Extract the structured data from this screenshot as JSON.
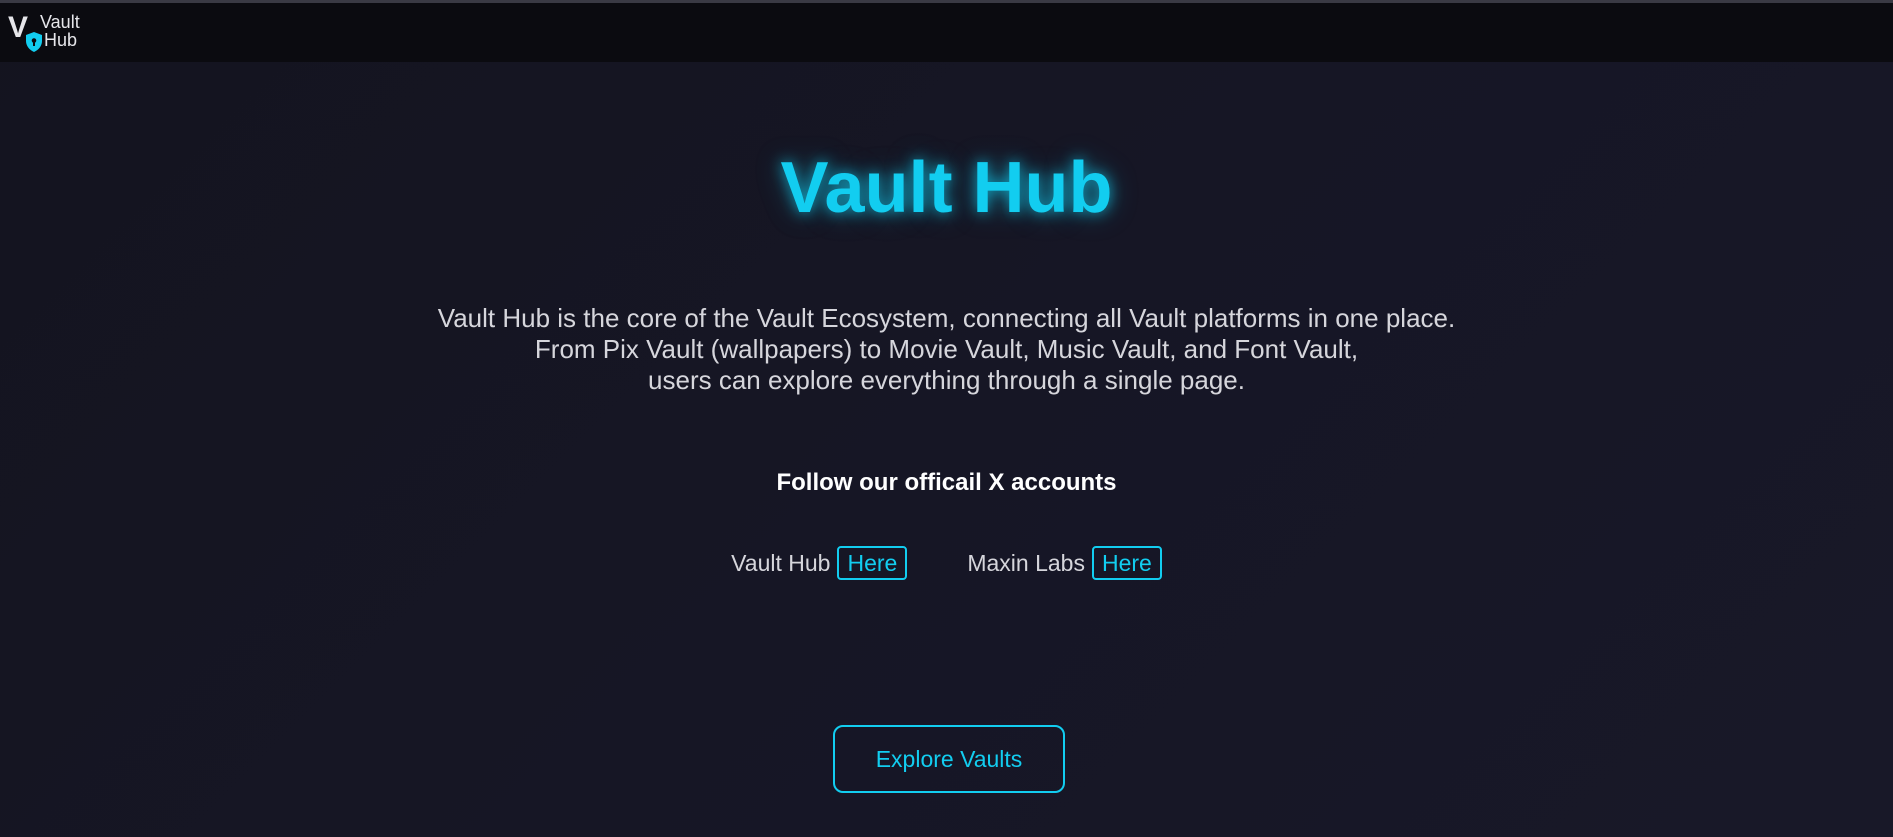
{
  "navbar": {
    "logo": {
      "mark": "V",
      "line1": "Vault",
      "line2": "Hub",
      "icon": "shield-lock-icon"
    }
  },
  "hero": {
    "title": "Vault Hub",
    "description": [
      "Vault Hub is the core of the Vault Ecosystem, connecting all Vault platforms in one place.",
      "From Pix Vault (wallpapers) to Movie Vault, Music Vault, and Font Vault,",
      "users can explore everything through a single page."
    ],
    "follow_heading": "Follow our officail X accounts",
    "accounts": [
      {
        "name": "Vault Hub",
        "link_label": "Here"
      },
      {
        "name": "Maxin Labs",
        "link_label": "Here"
      }
    ],
    "cta_label": "Explore Vaults"
  },
  "colors": {
    "accent": "#12cdf0",
    "background": "#161625",
    "navbar": "#0b0b10",
    "text": "#d6d6dc"
  }
}
